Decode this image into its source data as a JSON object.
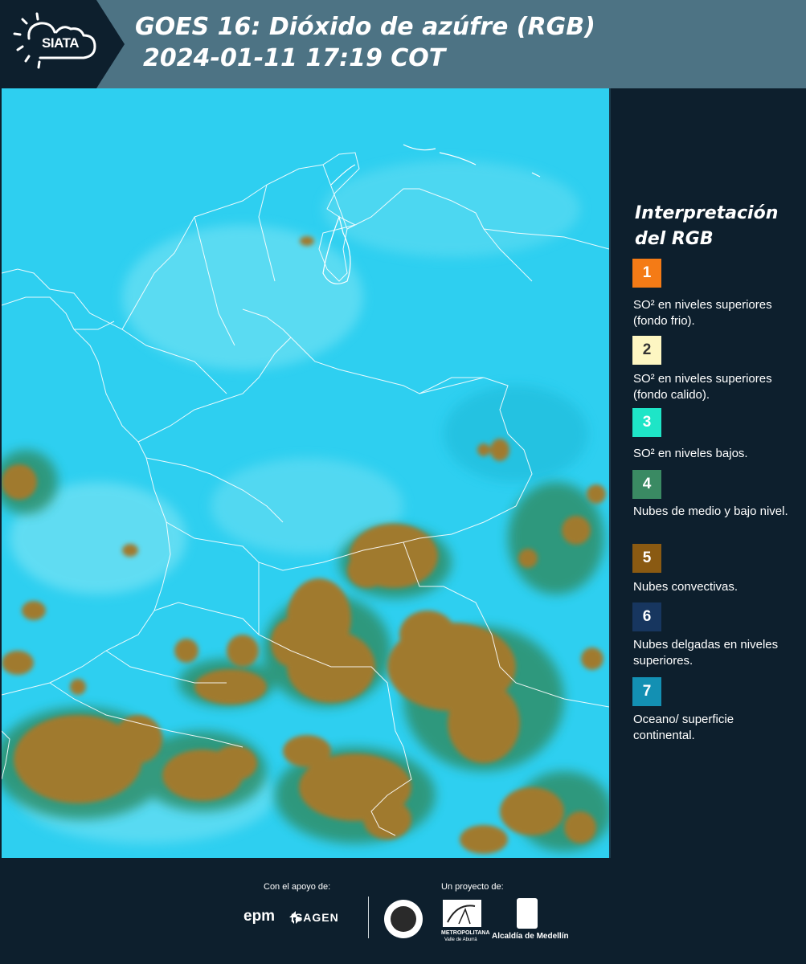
{
  "header": {
    "logo_text": "SIATA",
    "title_line1": "GOES 16: Dióxido de azúfre (RGB)",
    "title_line2": "2024-01-11 17:19 COT"
  },
  "legend": {
    "title_line1": "Interpretación",
    "title_line2": "del RGB",
    "items": [
      {
        "number": "1",
        "color": "#f47b16",
        "description": "SO² en niveles superiores (fondo frio)."
      },
      {
        "number": "2",
        "color": "#fdf6c2",
        "description": "SO² en niveles superiores (fondo calido)."
      },
      {
        "number": "3",
        "color": "#1ee5c7",
        "description": "SO² en niveles bajos."
      },
      {
        "number": "4",
        "color": "#3a8a63",
        "description": "Nubes de medio y bajo nivel."
      },
      {
        "number": "5",
        "color": "#8a5a12",
        "description": "Nubes convectivas."
      },
      {
        "number": "6",
        "color": "#17365f",
        "description": "Nubes delgadas en niveles superiores."
      },
      {
        "number": "7",
        "color": "#1390b3",
        "description": "Oceano/ superficie continental."
      }
    ]
  },
  "map": {
    "background_color": "#2ecff0",
    "cloud_color": "#a17a2c",
    "border_color": "#ffffff"
  },
  "footer": {
    "support_label": "Con el apoyo de:",
    "project_label": "Un proyecto de:",
    "sponsor1": "epm",
    "sponsor2": "ISAGEN",
    "partner_metro": "METROPOLITANA",
    "partner_metro_sub": "Valle de Aburrá",
    "partner_alcaldia": "Alcaldía de Medellín"
  }
}
